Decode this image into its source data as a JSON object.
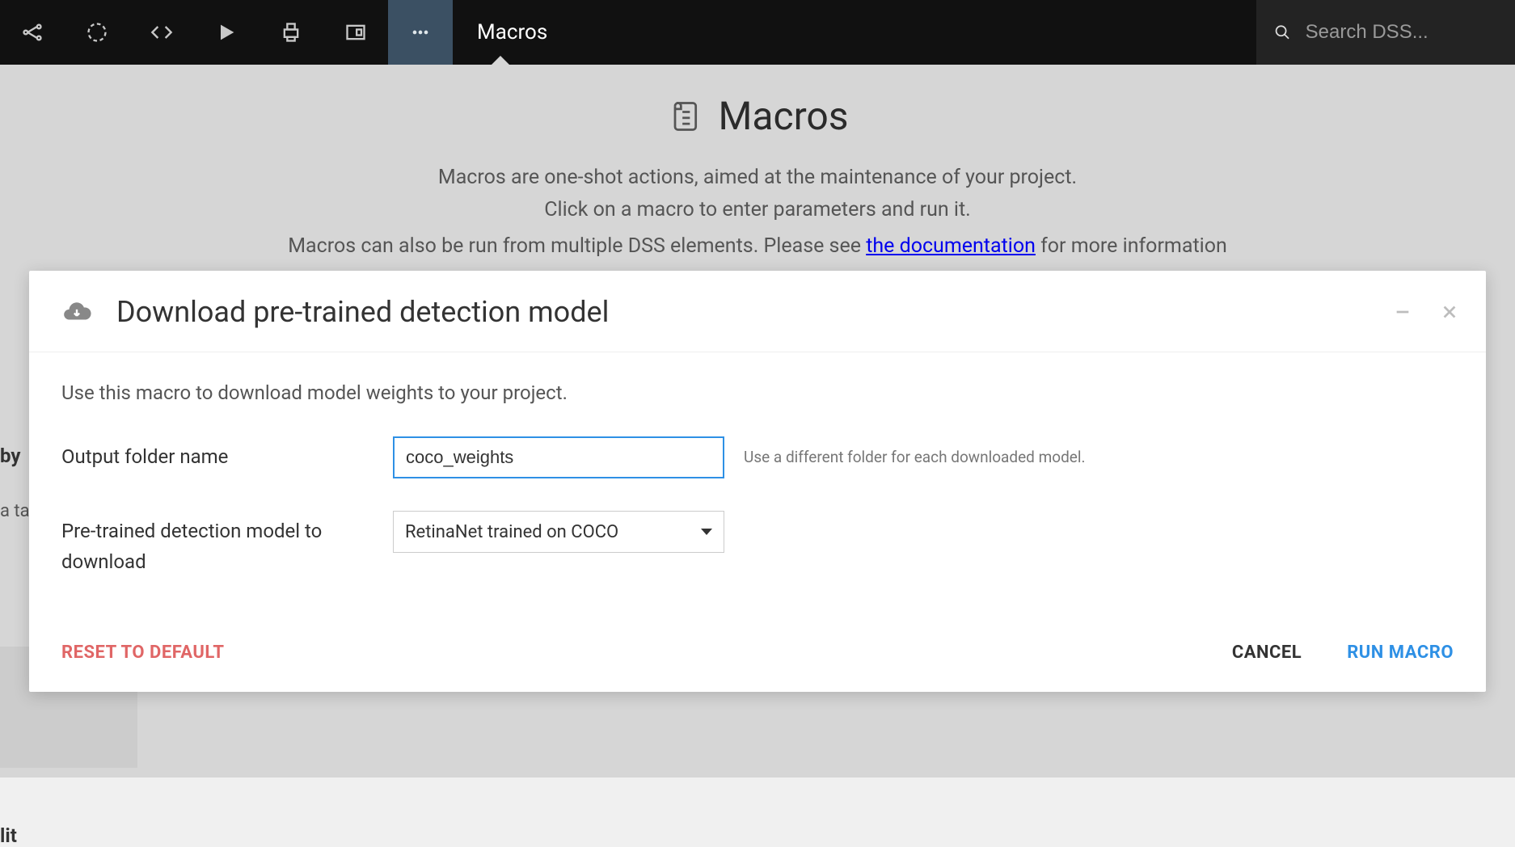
{
  "topbar": {
    "title": "Macros",
    "search_placeholder": "Search DSS..."
  },
  "page": {
    "title": "Macros",
    "desc_line1": "Macros are one-shot actions, aimed at the maintenance of your project.",
    "desc_line2": "Click on a macro to enter parameters and run it.",
    "cut_left": "Macros can also be run from multiple DSS elements. Please see ",
    "cut_link": "the documentation",
    "cut_right": " for more information",
    "bg_by": "by",
    "bg_ata": "a ta",
    "bg_lit": "lit"
  },
  "modal": {
    "title": "Download pre-trained detection model",
    "intro": "Use this macro to download model weights to your project.",
    "fields": {
      "output_folder": {
        "label": "Output folder name",
        "value": "coco_weights",
        "hint": "Use a different folder for each downloaded model."
      },
      "model": {
        "label": "Pre-trained detection model to download",
        "selected": "RetinaNet trained on COCO"
      }
    },
    "buttons": {
      "reset": "RESET TO DEFAULT",
      "cancel": "CANCEL",
      "run": "RUN MACRO"
    }
  }
}
